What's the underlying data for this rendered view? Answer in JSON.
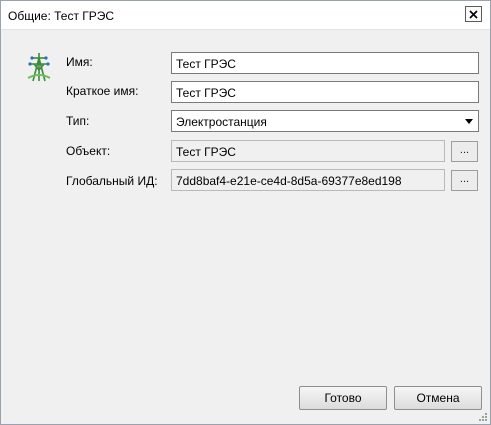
{
  "window": {
    "title": "Общие: Тест ГРЭС",
    "close_icon": "close-icon"
  },
  "icon": "power-station-icon",
  "fields": {
    "name": {
      "label": "Имя:",
      "value": "Тест ГРЭС"
    },
    "short_name": {
      "label": "Краткое имя:",
      "value": "Тест ГРЭС"
    },
    "type": {
      "label": "Тип:",
      "value": "Электростанция"
    },
    "object": {
      "label": "Объект:",
      "value": "Тест ГРЭС",
      "button": "..."
    },
    "global_id": {
      "label": "Глобальный ИД:",
      "value": "7dd8baf4-e21e-ce4d-8d5a-69377e8ed198",
      "button": "..."
    }
  },
  "buttons": {
    "ok": "Готово",
    "cancel": "Отмена"
  }
}
